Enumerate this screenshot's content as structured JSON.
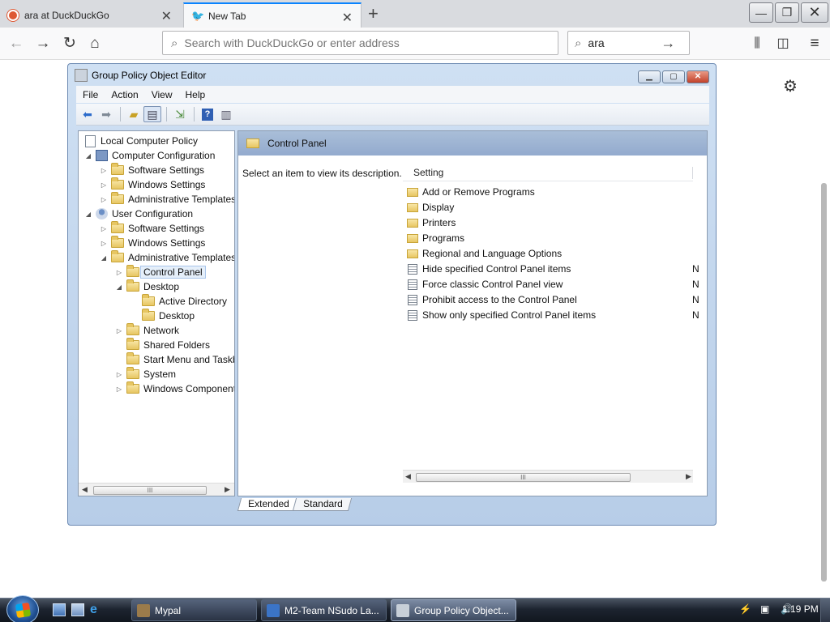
{
  "browser": {
    "tabs": [
      {
        "title": "ara at DuckDuckGo",
        "active": false
      },
      {
        "title": "New Tab",
        "active": true
      }
    ],
    "new_tab_symbol": "+",
    "url_placeholder": "Search with DuckDuckGo or enter address",
    "search_value": "ara",
    "accent_color": "#0a84ff"
  },
  "gpedit": {
    "title": "Group Policy Object Editor",
    "menu": [
      "File",
      "Action",
      "View",
      "Help"
    ],
    "tree": [
      {
        "label": "Local Computer Policy",
        "level": 0,
        "icon": "policy-doc-icon",
        "arrow": ""
      },
      {
        "label": "Computer Configuration",
        "level": 1,
        "icon": "computer-icon",
        "arrow": "expanded"
      },
      {
        "label": "Software Settings",
        "level": 2,
        "icon": "folder-icon",
        "arrow": "collapsed"
      },
      {
        "label": "Windows Settings",
        "level": 2,
        "icon": "folder-icon",
        "arrow": "collapsed"
      },
      {
        "label": "Administrative Templates",
        "level": 2,
        "icon": "folder-icon",
        "arrow": "collapsed"
      },
      {
        "label": "User Configuration",
        "level": 1,
        "icon": "user-icon",
        "arrow": "expanded"
      },
      {
        "label": "Software Settings",
        "level": 2,
        "icon": "folder-icon",
        "arrow": "collapsed"
      },
      {
        "label": "Windows Settings",
        "level": 2,
        "icon": "folder-icon",
        "arrow": "collapsed"
      },
      {
        "label": "Administrative Templates",
        "level": 2,
        "icon": "folder-icon",
        "arrow": "expanded"
      },
      {
        "label": "Control Panel",
        "level": 3,
        "icon": "folder-icon",
        "arrow": "collapsed",
        "selected": true
      },
      {
        "label": "Desktop",
        "level": 3,
        "icon": "folder-icon",
        "arrow": "expanded"
      },
      {
        "label": "Active Directory",
        "level": 4,
        "icon": "folder-icon",
        "arrow": ""
      },
      {
        "label": "Desktop",
        "level": 4,
        "icon": "folder-icon",
        "arrow": ""
      },
      {
        "label": "Network",
        "level": 3,
        "icon": "folder-icon",
        "arrow": "collapsed"
      },
      {
        "label": "Shared Folders",
        "level": 3,
        "icon": "folder-icon",
        "arrow": ""
      },
      {
        "label": "Start Menu and Taskbar",
        "level": 3,
        "icon": "folder-icon",
        "arrow": ""
      },
      {
        "label": "System",
        "level": 3,
        "icon": "folder-icon",
        "arrow": "collapsed"
      },
      {
        "label": "Windows Components",
        "level": 3,
        "icon": "folder-icon",
        "arrow": "collapsed"
      }
    ],
    "right_header": "Control Panel",
    "description": "Select an item to view its description.",
    "column_header": "Setting",
    "settings": [
      {
        "label": "Add or Remove Programs",
        "type": "folder",
        "state": ""
      },
      {
        "label": "Display",
        "type": "folder",
        "state": ""
      },
      {
        "label": "Printers",
        "type": "folder",
        "state": ""
      },
      {
        "label": "Programs",
        "type": "folder",
        "state": ""
      },
      {
        "label": "Regional and Language Options",
        "type": "folder",
        "state": ""
      },
      {
        "label": "Hide specified Control Panel items",
        "type": "policy",
        "state": "N"
      },
      {
        "label": "Force classic Control Panel view",
        "type": "policy",
        "state": "N"
      },
      {
        "label": "Prohibit access to the Control Panel",
        "type": "policy",
        "state": "N"
      },
      {
        "label": "Show only specified Control Panel items",
        "type": "policy",
        "state": "N"
      }
    ],
    "view_tabs": [
      "Extended",
      "Standard"
    ],
    "scroll_thumb_glyph": "III"
  },
  "taskbar": {
    "tasks": [
      {
        "label": "Mypal",
        "active": false
      },
      {
        "label": "M2-Team NSudo La...",
        "active": false
      },
      {
        "label": "Group Policy Object...",
        "active": true
      }
    ],
    "clock": "1:19 PM"
  }
}
